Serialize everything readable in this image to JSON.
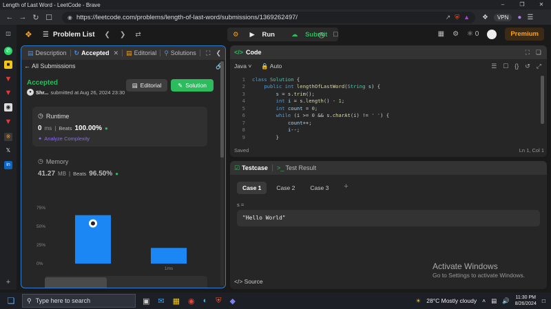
{
  "window": {
    "title": "Length of Last Word - LeetCode - Brave"
  },
  "browser": {
    "url": "https://leetcode.com/problems/length-of-last-word/submissions/1369262497/",
    "vpn_label": "VPN"
  },
  "header": {
    "problem_list": "Problem List",
    "run": "Run",
    "submit": "Submit",
    "streak": "0",
    "premium": "Premium"
  },
  "left_tabs": [
    {
      "label": "Description"
    },
    {
      "label": "Accepted"
    },
    {
      "label": "Editorial"
    },
    {
      "label": "Solutions"
    }
  ],
  "submission": {
    "back_label": "All Submissions",
    "status": "Accepted",
    "user": "Shr...",
    "submitted_at": "submitted at Aug 26, 2024 23:30",
    "editorial_btn": "Editorial",
    "solution_btn": "Solution"
  },
  "runtime": {
    "label": "Runtime",
    "value": "0",
    "unit": "ms",
    "beats_label": "Beats",
    "beats_pct": "100.00%",
    "analyze": "Analyze Complexity"
  },
  "memory": {
    "label": "Memory",
    "value": "41.27",
    "unit": "MB",
    "beats_label": "Beats",
    "beats_pct": "96.50%"
  },
  "chart_data": {
    "type": "bar",
    "yticks": [
      "75%",
      "50%",
      "25%",
      "0%"
    ],
    "ylim": [
      0,
      85
    ],
    "bars": [
      {
        "label": "",
        "value": 65,
        "color": "#1b87f4",
        "marker": true
      },
      {
        "label": "1ms",
        "value": 21,
        "color": "#1b87f4"
      }
    ],
    "xlabels": [
      "1ms"
    ]
  },
  "code": {
    "title": "Code",
    "language": "Java",
    "mode": "Auto",
    "lines": [
      {
        "n": "1",
        "html": "<span class='kw'>class</span> <span class='ty'>Solution</span> <span class='pl'>{</span>"
      },
      {
        "n": "2",
        "html": "    <span class='kw'>public</span> <span class='kw'>int</span> <span class='fn'>lengthOfLastWord</span><span class='pl'>(</span><span class='ty'>String</span> <span class='vr'>s</span><span class='pl'>) {</span>"
      },
      {
        "n": "3",
        "html": "        <span class='vr'>s</span> <span class='pl'>= s.</span><span class='fn'>trim</span><span class='pl'>();</span>"
      },
      {
        "n": "4",
        "html": "        <span class='kw'>int</span> <span class='vr'>i</span> <span class='pl'>= s.</span><span class='fn'>length</span><span class='pl'>() - </span><span class='nm'>1</span><span class='pl'>;</span>"
      },
      {
        "n": "5",
        "html": "        <span class='kw'>int</span> <span class='vr'>count</span> <span class='pl'>= </span><span class='nm'>0</span><span class='pl'>;</span>"
      },
      {
        "n": "6",
        "html": "        <span class='kw'>while</span> <span class='pl'>(i >= </span><span class='nm'>0</span> <span class='pl'>&amp;&amp; s.</span><span class='fn'>charAt</span><span class='pl'>(i) != </span><span class='st'>' '</span><span class='pl'>) {</span>"
      },
      {
        "n": "7",
        "html": "            <span class='vr'>count</span><span class='pl'>++;</span>"
      },
      {
        "n": "8",
        "html": "            <span class='vr'>i</span><span class='pl'>--;</span>"
      },
      {
        "n": "9",
        "html": "        <span class='pl'>}</span>"
      }
    ],
    "saved": "Saved",
    "cursor": "Ln 1, Col 1"
  },
  "testcase": {
    "tab": "Testcase",
    "result_tab": "Test Result",
    "cases": [
      "Case 1",
      "Case 2",
      "Case 3"
    ],
    "var_label": "s =",
    "value": "\"Hello World\"",
    "source": "Source"
  },
  "watermark": {
    "title": "Activate Windows",
    "subtitle": "Go to Settings to activate Windows."
  },
  "taskbar": {
    "search_placeholder": "Type here to search",
    "weather": "28°C  Mostly cloudy",
    "time": "11:30 PM",
    "date": "8/26/2024"
  }
}
